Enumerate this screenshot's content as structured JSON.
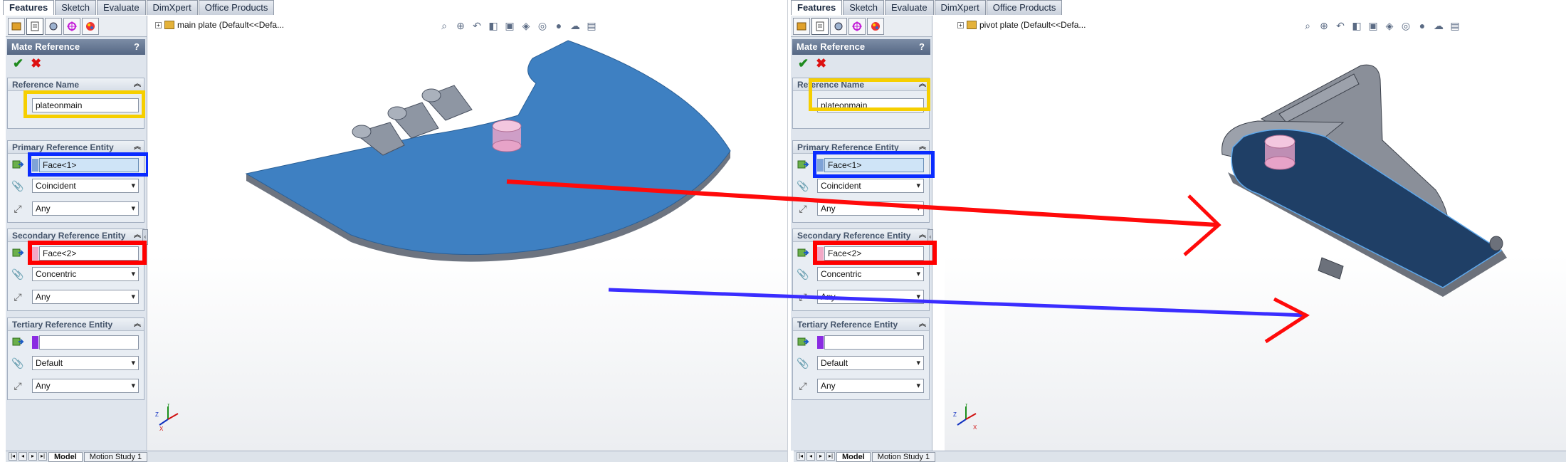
{
  "command_tabs": [
    "Features",
    "Sketch",
    "Evaluate",
    "DimXpert",
    "Office Products"
  ],
  "bottom_tabs": [
    "Model",
    "Motion Study 1"
  ],
  "icons": {
    "manager_tabs": [
      "feature-manager-icon",
      "property-manager-icon",
      "configuration-manager-icon",
      "dimxpert-manager-icon",
      "display-manager-icon"
    ],
    "heads_up": [
      "zoom-to-fit-icon",
      "zoom-area-icon",
      "previous-view-icon",
      "section-view-icon",
      "view-orientation-icon",
      "display-style-icon",
      "hide-show-icon",
      "edit-appearance-icon",
      "apply-scene-icon",
      "view-settings-icon"
    ]
  },
  "colors": {
    "highlight_yellow": "#f6cf00",
    "highlight_blue": "#0a2cff",
    "highlight_red": "#ff0000",
    "arrow_red": "#ff0a0a",
    "arrow_blue": "#3a2dff",
    "part_blue": "#3f80c0",
    "part_dark": "#1e3f66",
    "part_grey": "#8a8f99"
  },
  "panes": [
    {
      "document_title": "main plate  (Default<<Defa...",
      "panel": {
        "title": "Mate Reference",
        "help": "?",
        "reference_name": {
          "header": "Reference Name",
          "value": "plateonmain"
        },
        "primary": {
          "header": "Primary Reference Entity",
          "entity": "Face<1>",
          "mate_type": "Coincident",
          "alignment": "Any"
        },
        "secondary": {
          "header": "Secondary Reference Entity",
          "entity": "Face<2>",
          "mate_type": "Concentric",
          "alignment": "Any"
        },
        "tertiary": {
          "header": "Tertiary Reference Entity",
          "entity": "",
          "mate_type": "Default",
          "alignment": "Any"
        }
      },
      "triad": {
        "x": "X",
        "y": "Y",
        "z": "Z"
      }
    },
    {
      "document_title": "pivot plate  (Default<<Defa...",
      "panel": {
        "title": "Mate Reference",
        "help": "?",
        "reference_name": {
          "header": "Reference Name",
          "value": "plateonmain"
        },
        "primary": {
          "header": "Primary Reference Entity",
          "entity": "Face<1>",
          "mate_type": "Coincident",
          "alignment": "Any"
        },
        "secondary": {
          "header": "Secondary Reference Entity",
          "entity": "Face<2>",
          "mate_type": "Concentric",
          "alignment": "Any"
        },
        "tertiary": {
          "header": "Tertiary Reference Entity",
          "entity": "",
          "mate_type": "Default",
          "alignment": "Any"
        }
      },
      "triad": {
        "x": "X",
        "y": "Y",
        "z": "Z"
      }
    }
  ]
}
